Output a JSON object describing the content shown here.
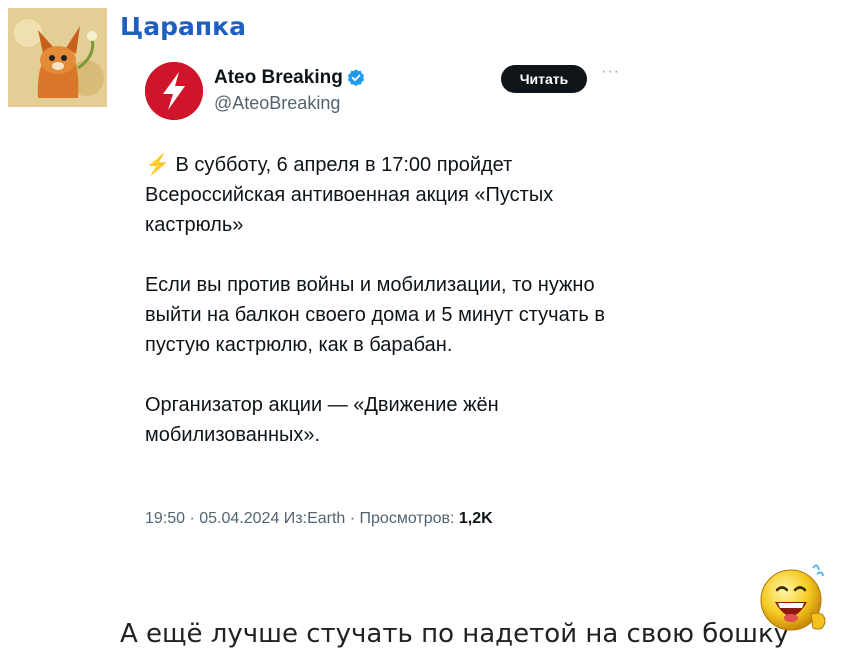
{
  "post": {
    "author": "Царапка",
    "avatar_icon": "cartoon-fox-avatar",
    "reply_text": "А ещё лучше стучать по надетой на свою бошку",
    "emoji": "laughing-smiley-icon"
  },
  "tweet": {
    "display_name": "Ateo Breaking",
    "handle": "@AteoBreaking",
    "follow_label": "Читать",
    "more_label": "···",
    "bolt_glyph": "⚡",
    "paragraph_1": "В субботу, 6 апреля в 17:00 пройдет Всероссийская антивоенная акция «Пустых кастрюль»",
    "paragraph_2": "Если вы против войны и мобилизации, то нужно выйти на балкон своего дома и 5 минут стучать в пустую кастрюлю, как в барабан.",
    "paragraph_3": "Организатор акции — «Движение жён мобилизованных».",
    "meta_prefix": "19:50 · 05.04.2024 Из:Earth · Просмотров: ",
    "views": "1,2K"
  },
  "colors": {
    "author_name": "#1f5fbf",
    "logo_red": "#d0142a",
    "verified_blue": "#1d9bf0",
    "follow_bg": "#0f1419"
  }
}
